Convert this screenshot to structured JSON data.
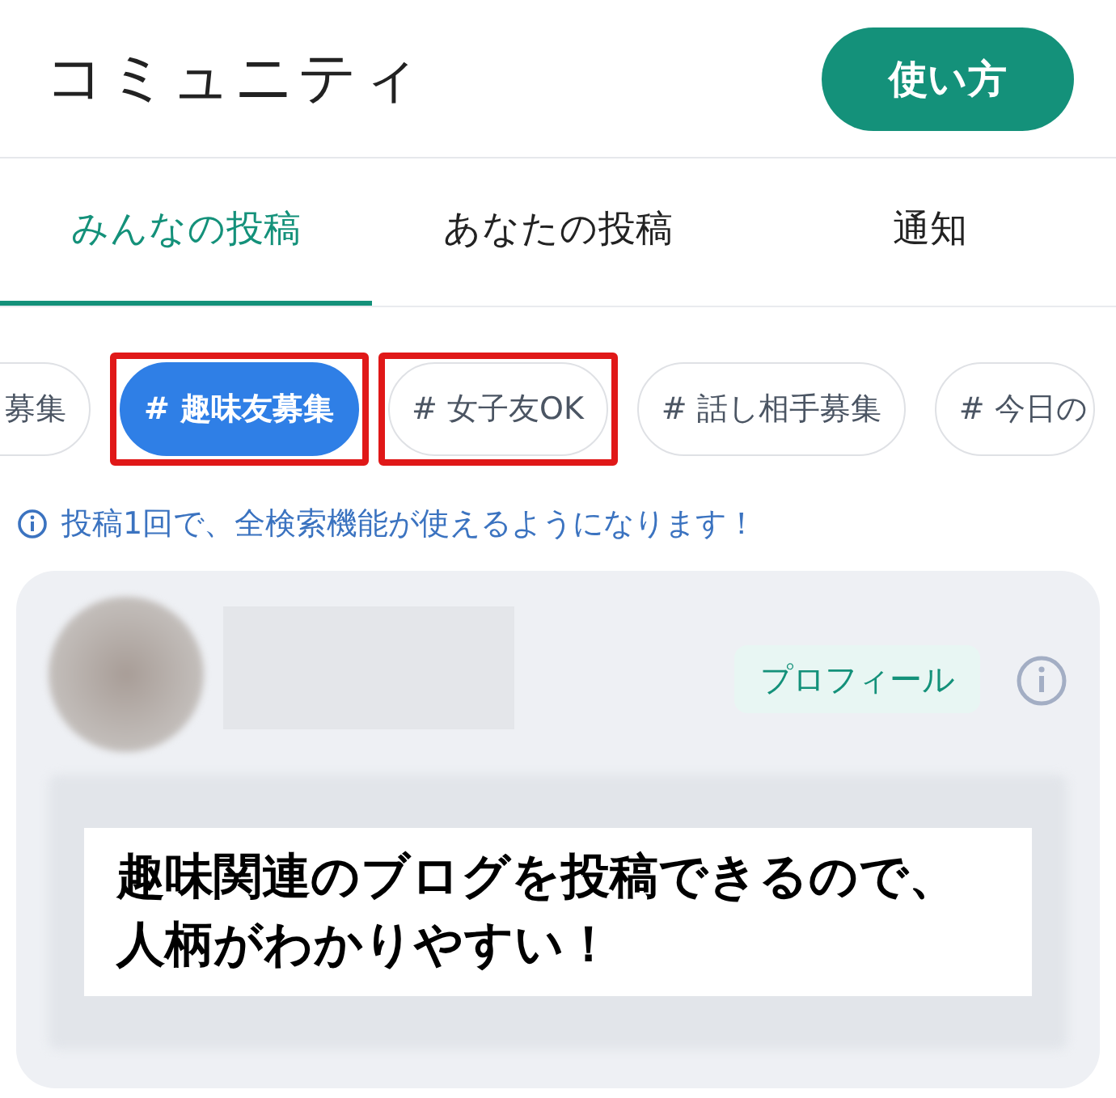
{
  "header": {
    "title": "コミュニティ",
    "help_button": "使い方"
  },
  "tabs": [
    {
      "label": "みんなの投稿",
      "selected": true
    },
    {
      "label": "あなたの投稿",
      "selected": false
    },
    {
      "label": "通知",
      "selected": false
    }
  ],
  "tags": [
    {
      "label": "募集",
      "selected": false,
      "highlighted": false
    },
    {
      "label": "# 趣味友募集",
      "selected": true,
      "highlighted": true
    },
    {
      "label": "# 女子友OK",
      "selected": false,
      "highlighted": true
    },
    {
      "label": "# 話し相手募集",
      "selected": false,
      "highlighted": false
    },
    {
      "label": "# 今日の",
      "selected": false,
      "highlighted": false
    }
  ],
  "notice": "投稿1回で、全検索機能が使えるようになります！",
  "post": {
    "profile_button": "プロフィール"
  },
  "caption": [
    "趣味関連のブログを投稿できるので、",
    "人柄がわかりやすい！"
  ]
}
